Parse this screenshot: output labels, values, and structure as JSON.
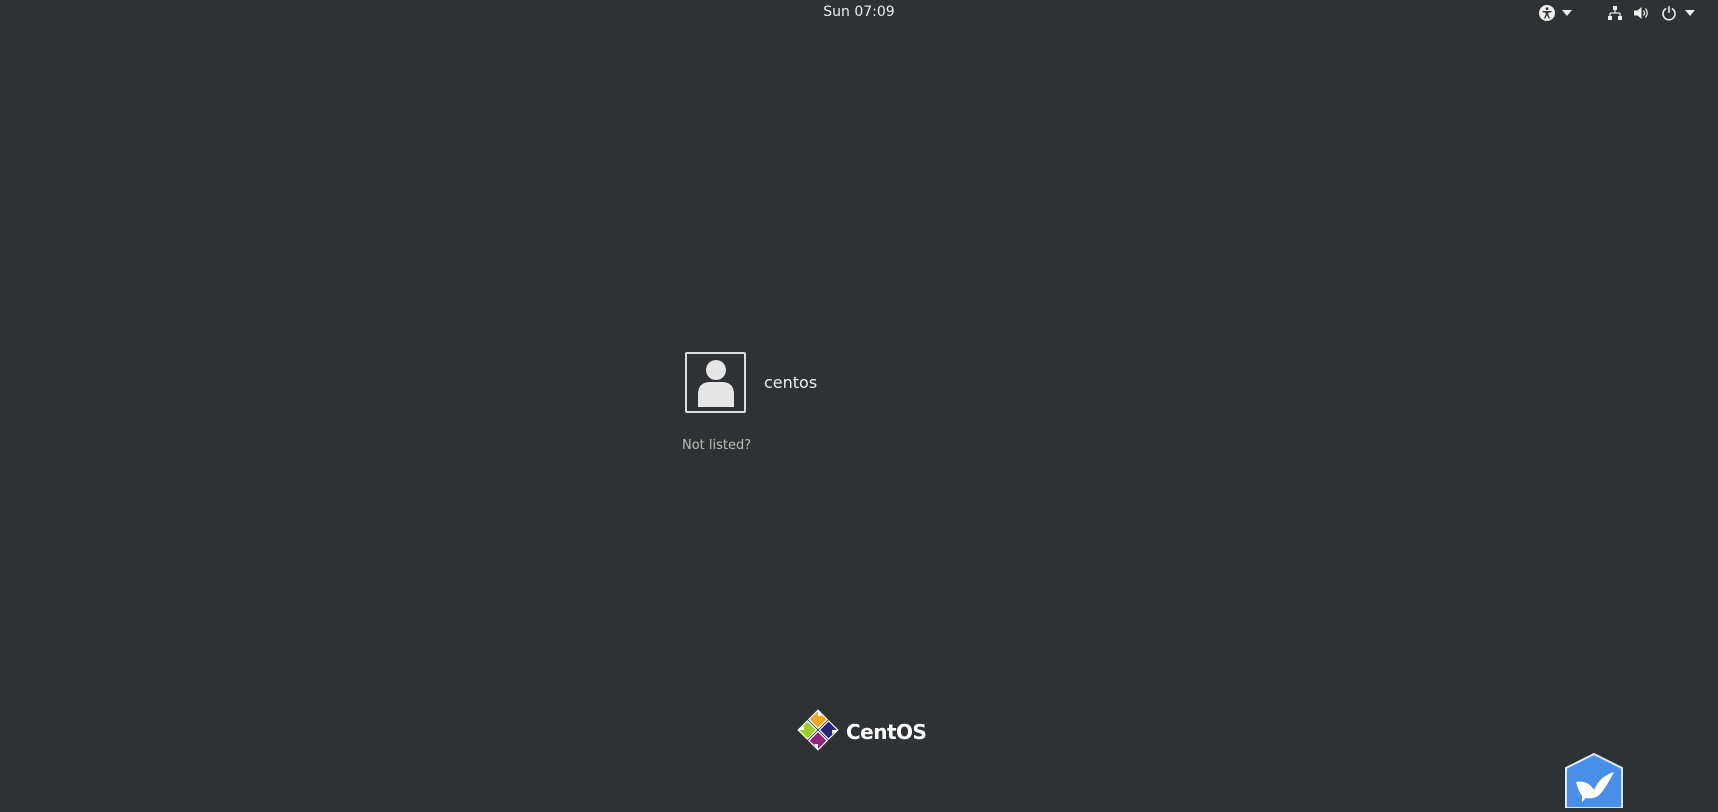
{
  "topbar": {
    "clock": "Sun 07:09",
    "icons": [
      "accessibility-icon",
      "dropdown-arrow-icon",
      "network-icon",
      "volume-icon",
      "power-icon",
      "dropdown-arrow-icon"
    ]
  },
  "users": [
    {
      "name": "centos",
      "avatar_icon": "default-user-avatar-icon"
    }
  ],
  "not_listed_label": "Not listed?",
  "branding": {
    "logo_text": "CentOS",
    "logo_icon": "centos-logo-icon"
  },
  "corner_app_icon": "bird-app-icon",
  "colors": {
    "background": "#2e3235",
    "text": "#eeeeec",
    "muted_text": "#babdb6",
    "corner_app": "#4a8fe7"
  }
}
